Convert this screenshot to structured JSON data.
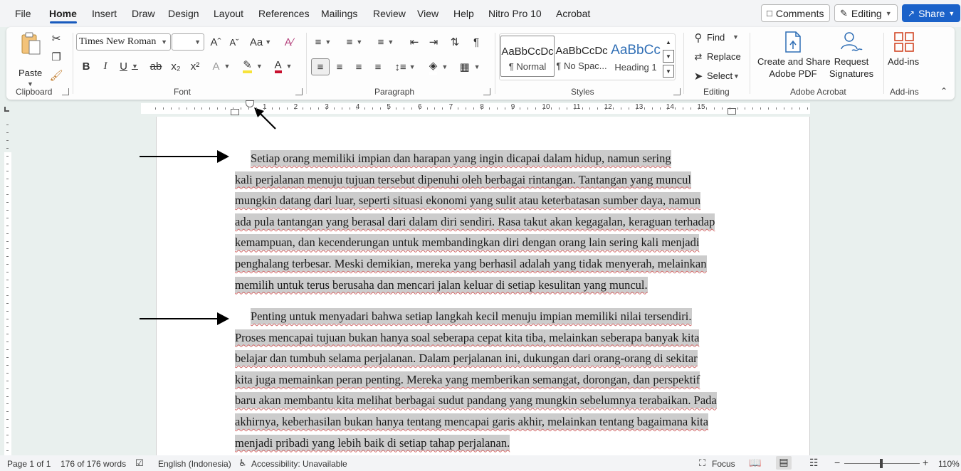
{
  "menu": {
    "items": [
      "File",
      "Home",
      "Insert",
      "Draw",
      "Design",
      "Layout",
      "References",
      "Mailings",
      "Review",
      "View",
      "Help",
      "Nitro Pro 10",
      "Acrobat"
    ],
    "active": "Home",
    "comments_label": "Comments",
    "editing_label": "Editing",
    "share_label": "Share"
  },
  "ribbon": {
    "clipboard": {
      "paste_label": "Paste",
      "group_label": "Clipboard"
    },
    "font": {
      "font_name": "Times New Roman",
      "font_size": "",
      "group_label": "Font"
    },
    "paragraph": {
      "group_label": "Paragraph"
    },
    "styles": {
      "group_label": "Styles",
      "items": [
        {
          "sample": "AaBbCcDc",
          "name": "¶ Normal"
        },
        {
          "sample": "AaBbCcDc",
          "name": "¶ No Spac..."
        },
        {
          "sample": "AaBbCc",
          "name": "Heading 1"
        }
      ],
      "heading_color": "#2f6eb5"
    },
    "editing": {
      "find_label": "Find",
      "replace_label": "Replace",
      "select_label": "Select",
      "group_label": "Editing"
    },
    "acrobat": {
      "create_label_1": "Create and Share",
      "create_label_2": "Adobe PDF",
      "request_label_1": "Request",
      "request_label_2": "Signatures",
      "group_label": "Adobe Acrobat"
    },
    "addins": {
      "label": "Add-ins",
      "group_label": "Add-ins"
    }
  },
  "ruler": {
    "numbers": [
      "1",
      "2",
      "3",
      "4",
      "5",
      "6",
      "7",
      "8",
      "9",
      "10",
      "11",
      "12",
      "13",
      "14",
      "15"
    ]
  },
  "document": {
    "paragraph1_lines": [
      "Setiap orang memiliki impian dan harapan yang ingin dicapai dalam hidup, namun sering",
      "kali perjalanan menuju tujuan tersebut dipenuhi oleh berbagai rintangan. Tantangan yang muncul",
      "mungkin datang dari luar, seperti situasi ekonomi yang sulit atau keterbatasan sumber daya, namun",
      "ada pula tantangan yang berasal dari dalam diri sendiri. Rasa takut akan kegagalan, keraguan terhadap",
      "kemampuan, dan kecenderungan untuk membandingkan diri dengan orang lain sering kali menjadi",
      "penghalang terbesar. Meski demikian, mereka yang berhasil adalah yang tidak menyerah, melainkan",
      "memilih untuk terus berusaha dan mencari jalan keluar di setiap kesulitan yang muncul."
    ],
    "paragraph2_lines": [
      "Penting untuk menyadari bahwa setiap langkah kecil menuju impian memiliki nilai tersendiri.",
      "Proses mencapai tujuan bukan hanya soal seberapa cepat kita tiba, melainkan seberapa banyak kita",
      "belajar dan tumbuh selama perjalanan. Dalam perjalanan ini, dukungan dari orang-orang di sekitar",
      "kita juga memainkan peran penting. Mereka yang memberikan semangat, dorongan, dan perspektif",
      "baru akan membantu kita melihat berbagai sudut pandang yang mungkin sebelumnya terabaikan. Pada",
      "akhirnya, keberhasilan bukan hanya tentang mencapai garis akhir, melainkan tentang bagaimana kita",
      "menjadi pribadi yang lebih baik di setiap tahap perjalanan."
    ]
  },
  "status": {
    "page": "Page 1 of 1",
    "words": "176 of 176 words",
    "language": "English (Indonesia)",
    "accessibility": "Accessibility: Unavailable",
    "focus": "Focus",
    "zoom": "110%"
  },
  "colors": {
    "accent": "#185abd",
    "share_bg": "#1b62c9",
    "highlight": "#cccccc"
  }
}
